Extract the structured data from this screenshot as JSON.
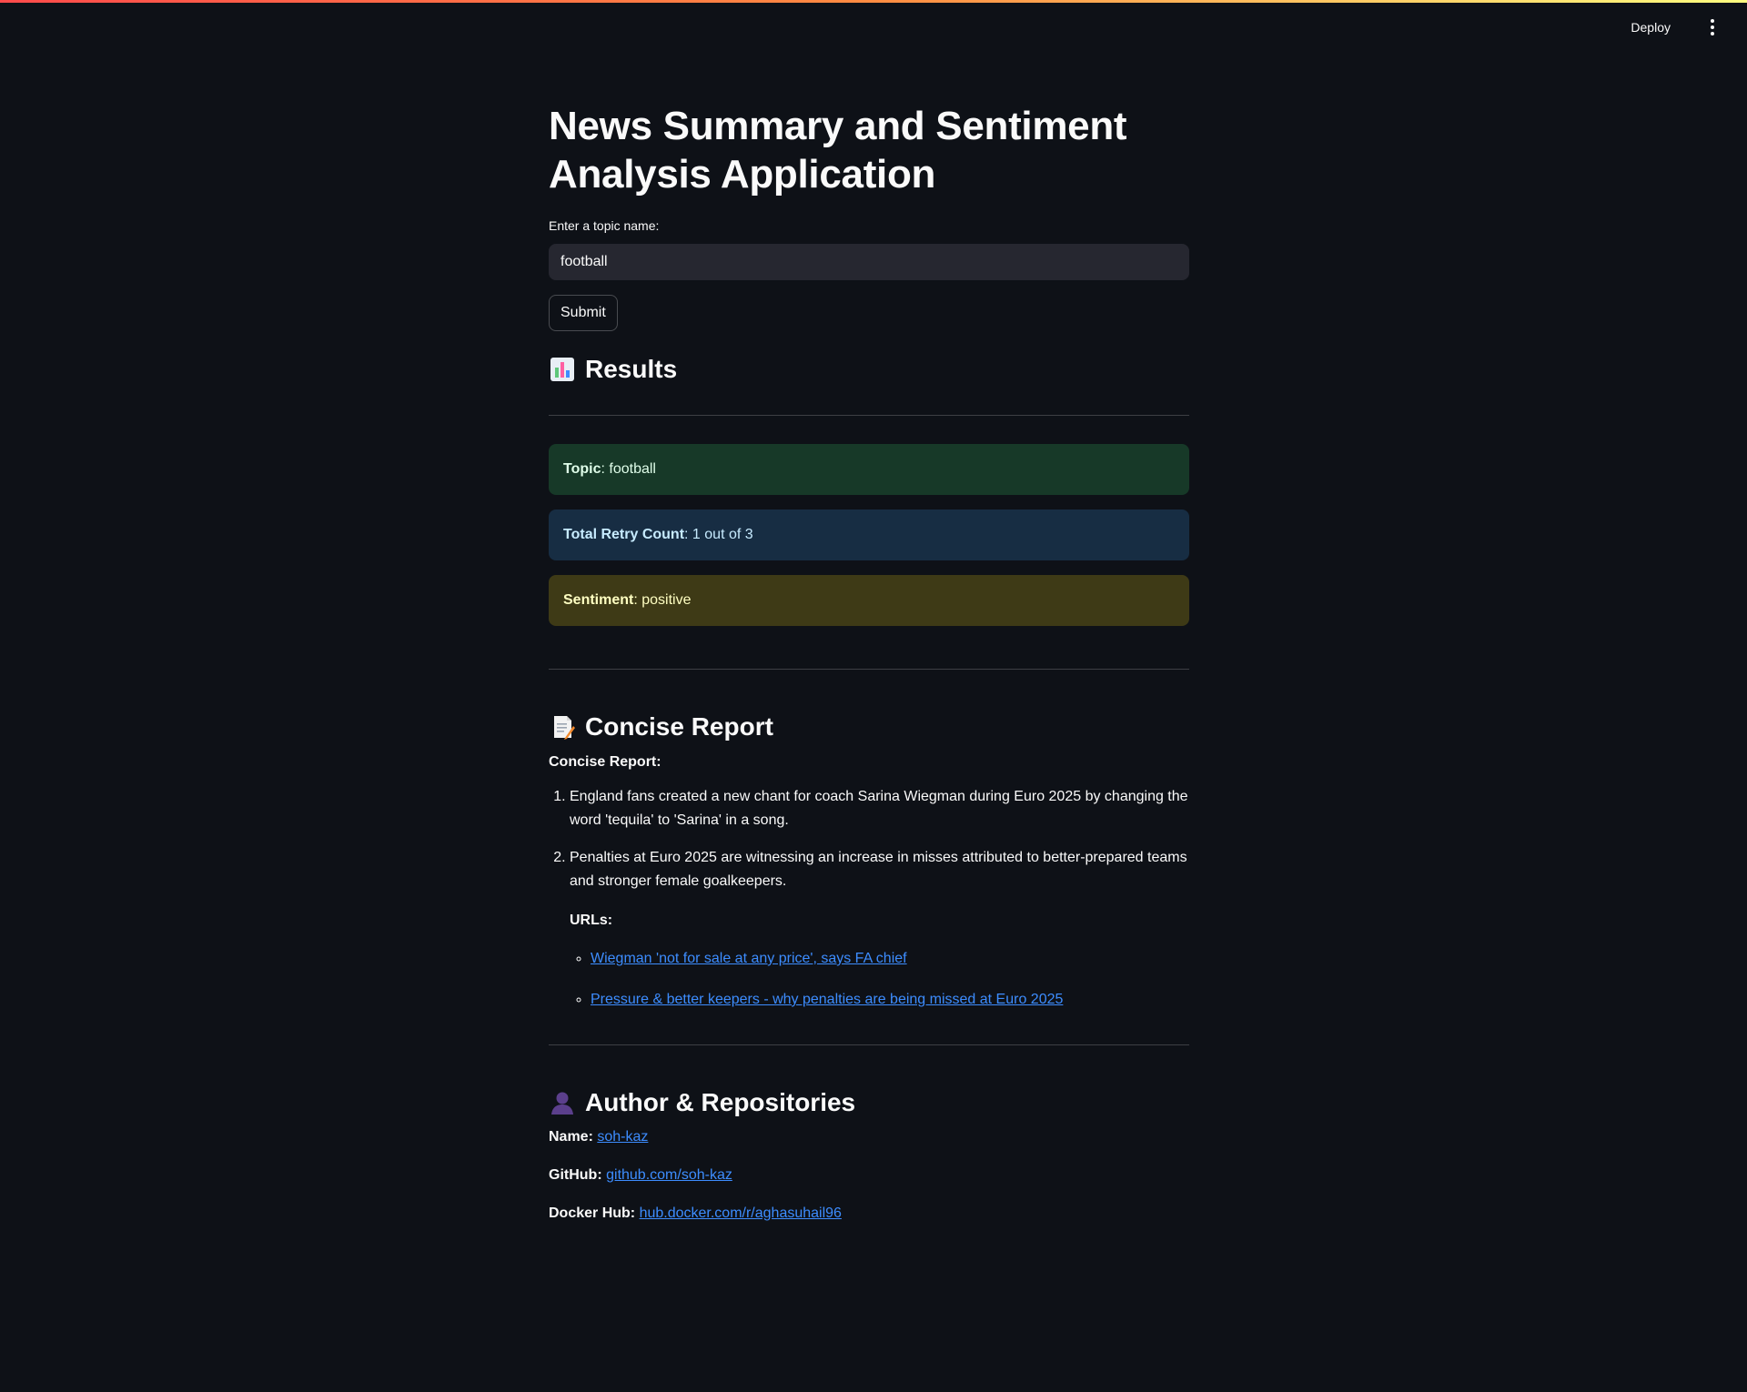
{
  "header": {
    "deploy_label": "Deploy",
    "menu_icon": "vertical-ellipsis-icon"
  },
  "page": {
    "title": "News Summary and Sentiment Analysis Application"
  },
  "topic_input": {
    "label": "Enter a topic name:",
    "value": "football"
  },
  "submit_label": "Submit",
  "results": {
    "heading": "Results",
    "icon": "bar-chart-icon",
    "topic_label": "Topic",
    "topic_value": ": football",
    "retry_label": "Total Retry Count",
    "retry_value": ": 1 out of 3",
    "sentiment_label": "Sentiment",
    "sentiment_value": ": positive",
    "colors": {
      "success_bg": "#173928",
      "info_bg": "#172d43",
      "warning_bg": "#3e3a16"
    }
  },
  "report": {
    "heading": "Concise Report",
    "icon": "memo-icon",
    "label": "Concise Report:",
    "items": [
      "England fans created a new chant for coach Sarina Wiegman during Euro 2025 by changing the word 'tequila' to 'Sarina' in a song.",
      "Penalties at Euro 2025 are witnessing an increase in misses attributed to better-prepared teams and stronger female goalkeepers."
    ],
    "urls_label": "URLs:",
    "urls": [
      "Wiegman 'not for sale at any price', says FA chief",
      "Pressure & better keepers - why penalties are being missed at Euro 2025"
    ]
  },
  "author": {
    "heading": "Author & Repositories",
    "icon": "user-silhouette-icon",
    "name_label": "Name:",
    "name_value": "soh-kaz",
    "github_label": "GitHub:",
    "github_value": "github.com/soh-kaz",
    "docker_label": "Docker Hub:",
    "docker_value": "hub.docker.com/r/aghasuhail96"
  },
  "theme": {
    "background": "#0e1117",
    "text": "#fafafa",
    "link": "#3d8dff",
    "input_bg": "#262730"
  }
}
